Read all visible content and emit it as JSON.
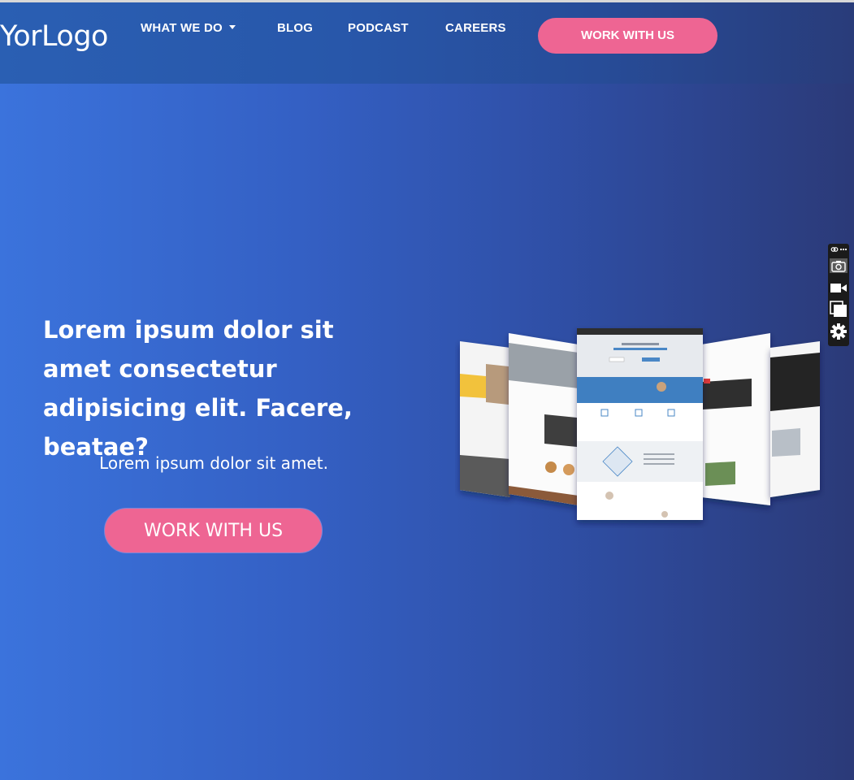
{
  "header": {
    "logo": "YorLogo",
    "nav": {
      "what_we_do": "WHAT WE DO",
      "blog": "BLOG",
      "podcast": "PODCAST",
      "careers": "CAREERS"
    },
    "cta": "WORK WITH US"
  },
  "hero": {
    "heading": "Lorem ipsum dolor sit amet consectetur adipisicing elit. Facere, beatae?",
    "subheading": "Lorem ipsum dolor sit amet.",
    "cta": "WORK WITH US"
  },
  "toolbar_icons": [
    "link-icon",
    "more-icon",
    "camera-icon",
    "video-icon",
    "copy-icon",
    "settings-icon"
  ],
  "colors": {
    "accent_pink": "#ee6593",
    "header_blue": "#2857aa",
    "bg_left": "#3b73dc",
    "bg_right": "#2b3a78"
  }
}
